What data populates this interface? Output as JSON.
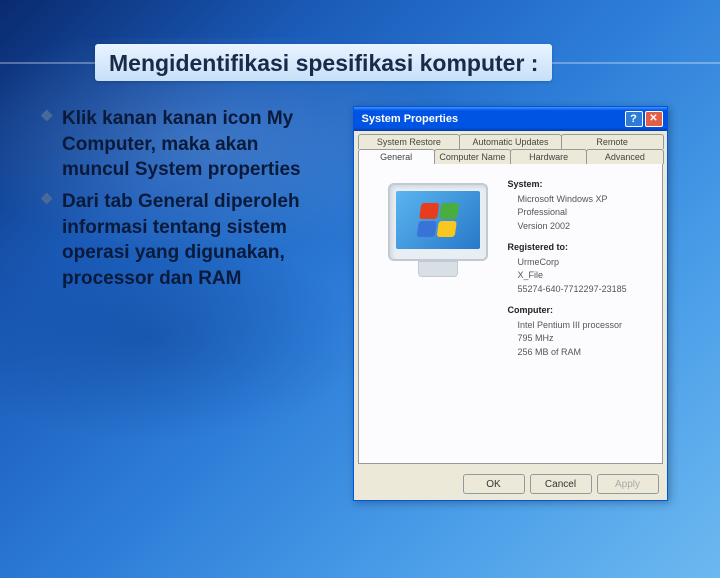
{
  "title": "Mengidentifikasi spesifikasi komputer :",
  "bullets": [
    "Klik kanan kanan icon My Computer, maka akan muncul System properties",
    "Dari tab General diperoleh informasi tentang sistem operasi yang digunakan, processor dan RAM"
  ],
  "sysprops": {
    "window_title": "System Properties",
    "tabs_row1": [
      "System Restore",
      "Automatic Updates",
      "Remote"
    ],
    "tabs_row2": [
      "General",
      "Computer Name",
      "Hardware",
      "Advanced"
    ],
    "active_tab": "General",
    "sections": {
      "system": {
        "heading": "System:",
        "lines": [
          "Microsoft Windows XP",
          "Professional",
          "Version 2002"
        ]
      },
      "registered": {
        "heading": "Registered to:",
        "lines": [
          "UrmeCorp",
          "X_File",
          "55274-640-7712297-23185"
        ]
      },
      "computer": {
        "heading": "Computer:",
        "lines": [
          "Intel Pentium III processor",
          "795 MHz",
          "256 MB of RAM"
        ]
      }
    },
    "buttons": {
      "ok": "OK",
      "cancel": "Cancel",
      "apply": "Apply"
    },
    "help_glyph": "?",
    "close_glyph": "✕"
  },
  "flag_colors": [
    "#e83c1e",
    "#4aae3e",
    "#3874d8",
    "#f8c820"
  ]
}
